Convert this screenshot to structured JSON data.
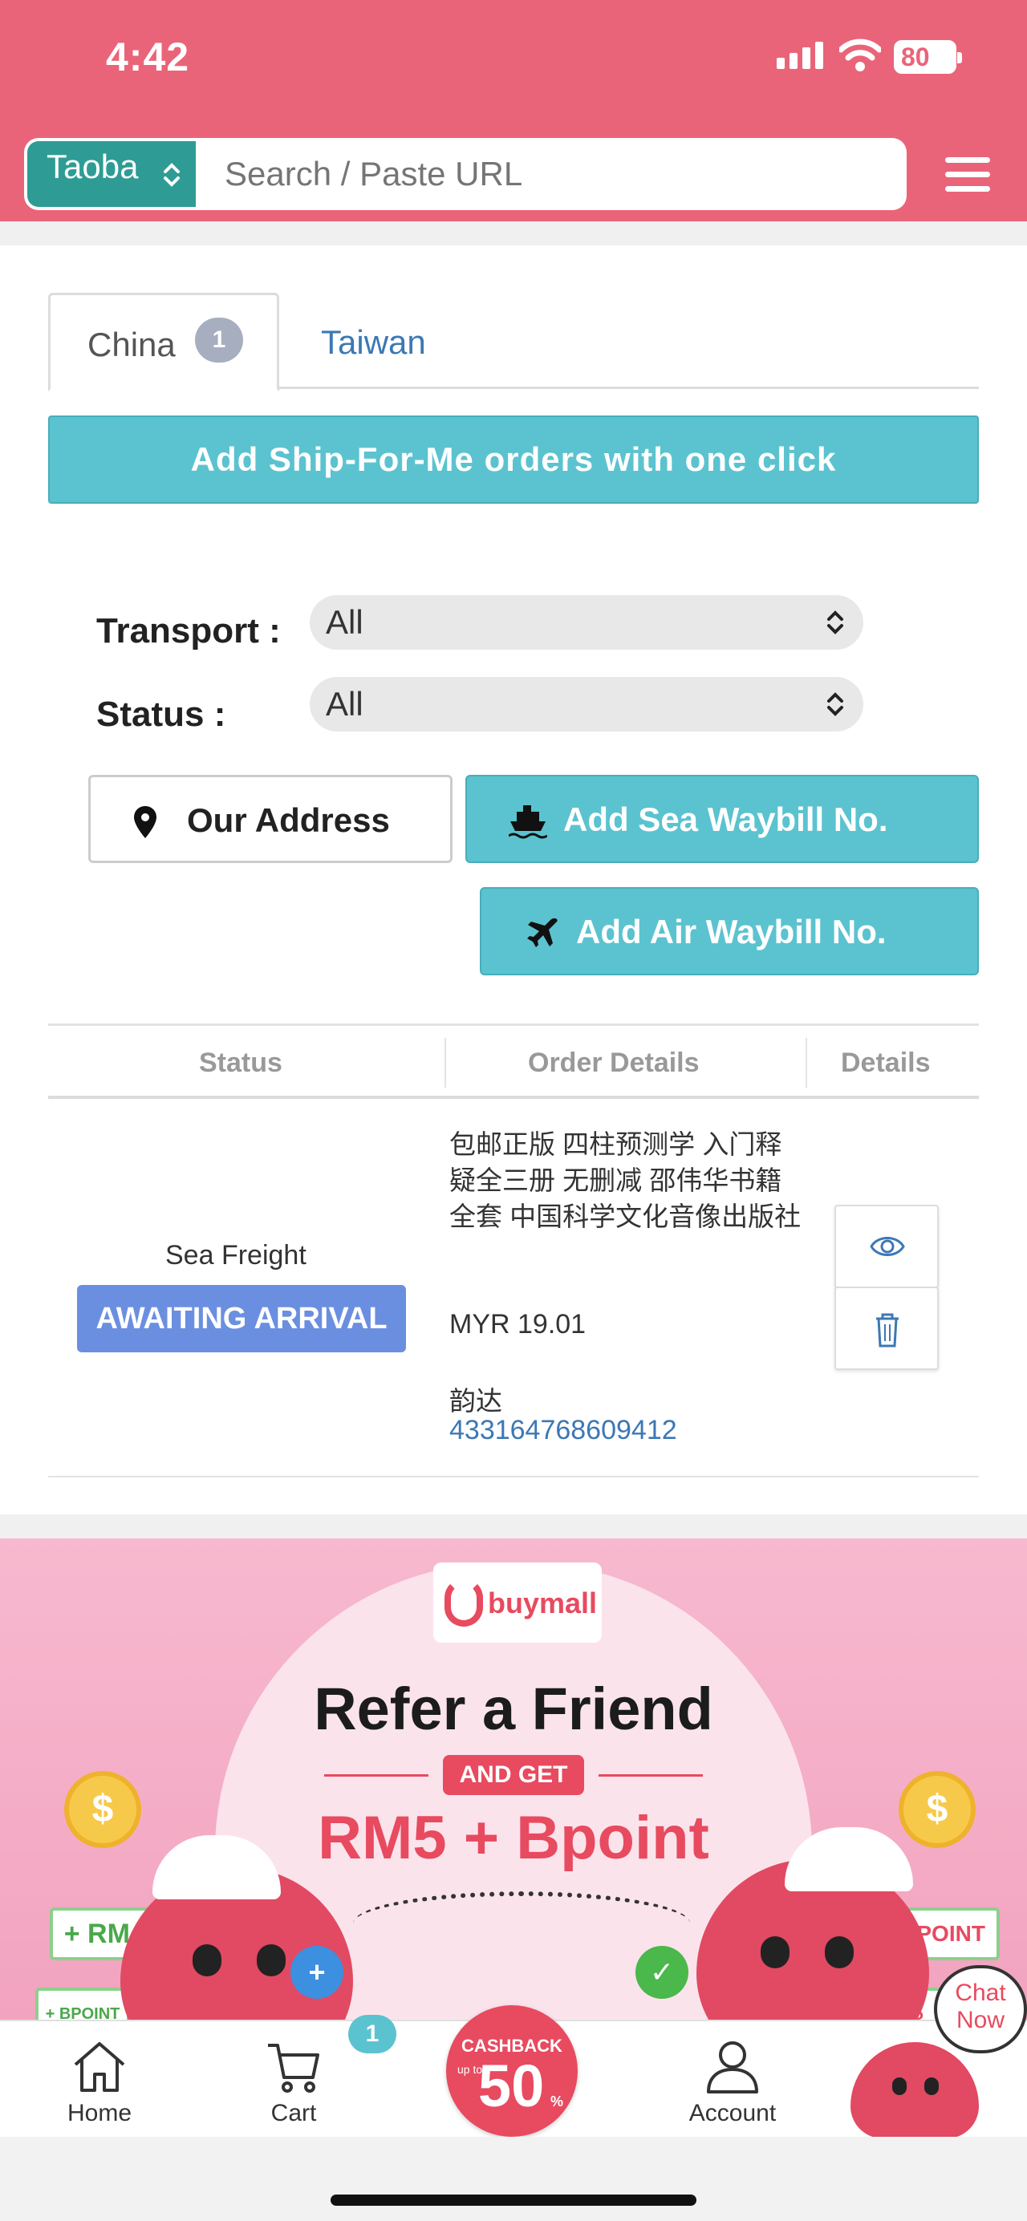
{
  "status_bar": {
    "time": "4:42",
    "battery": "80"
  },
  "search": {
    "platform": "Taoba",
    "placeholder": "Search / Paste URL"
  },
  "tabs": [
    {
      "label": "China",
      "badge": "1"
    },
    {
      "label": "Taiwan"
    }
  ],
  "ship_for_me_button": "Add Ship-For-Me orders with one click",
  "filters": {
    "transport_label": "Transport :",
    "transport_value": "All",
    "status_label": "Status :",
    "status_value": "All"
  },
  "actions": {
    "our_address": "Our Address",
    "add_sea_waybill": "Add Sea Waybill No.",
    "add_air_waybill": "Add Air Waybill No."
  },
  "table": {
    "headers": [
      "Status",
      "Order Details",
      "Details"
    ],
    "rows": [
      {
        "transport": "Sea Freight",
        "status": "AWAITING ARRIVAL",
        "title": "包邮正版 四柱预测学 入门释疑全三册 无删减 邵伟华书籍全套 中国科学文化音像出版社",
        "price": "MYR 19.01",
        "courier": "韵达",
        "tracking": "433164768609412"
      }
    ]
  },
  "banner": {
    "brand": "buymall",
    "headline": "Refer a Friend",
    "and_get": "AND GET",
    "reward": "RM5 + Bpoint",
    "tag_left": "+ RM 5",
    "tag_left_small": "+ BPOINT",
    "tag_right": "+ BPOINT",
    "tag_right_small": "+ RM 5",
    "coin_symbol": "$"
  },
  "bottom_nav": {
    "home": "Home",
    "cart": "Cart",
    "cart_badge": "1",
    "cashback_top": "CASHBACK",
    "cashback_upto": "up to",
    "cashback_value": "50",
    "cashback_unit": "%",
    "account": "Account",
    "chat_line1": "Chat",
    "chat_line2": "Now"
  },
  "colors": {
    "header": "#ea6479",
    "teal_button": "#5bc3cf",
    "platform_select": "#2e9c94",
    "awaiting_badge": "#6b8fe0",
    "link": "#3c78b5",
    "brand_red": "#e84a5f"
  }
}
